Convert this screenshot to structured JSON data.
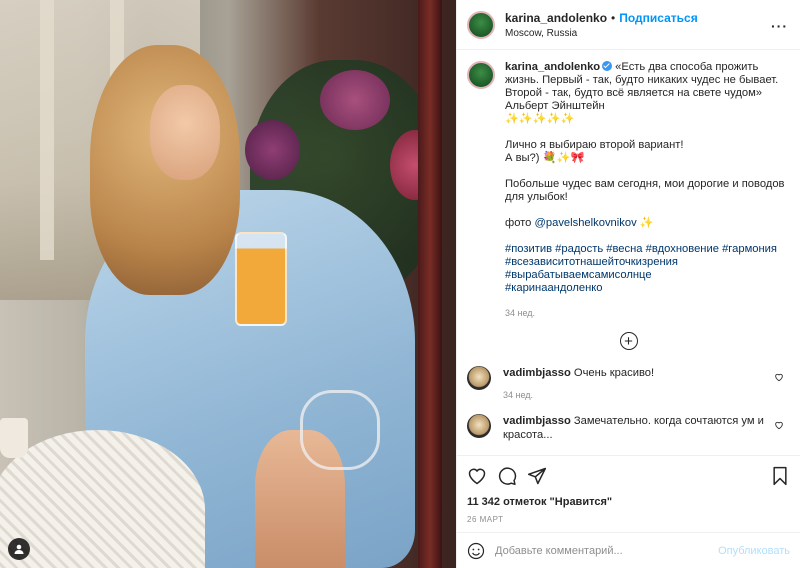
{
  "header": {
    "username": "karina_andolenko",
    "separator": "•",
    "follow_label": "Подписаться",
    "location": "Moscow, Russia",
    "more_label": "···"
  },
  "caption": {
    "username": "karina_andolenko",
    "paragraphs": [
      "«Есть два способа прожить жизнь. Первый - так, будто никаких чудес не бывает. Второй - так, будто всё является на свете чудом» Альберт Эйнштейн\n✨✨✨✨✨",
      "Лично я выбираю второй вариант!\nА вы?) 💐✨🎀",
      "Побольше чудес вам сегодня, мои дорогие и поводов для улыбок!"
    ],
    "photo_prefix": "фото ",
    "photo_credit": "@pavelshelkovnikov",
    "photo_suffix": " ✨",
    "hashtags_line1": "#позитив #радость #весна #вдохновение #гармония",
    "hashtags_line2": "#всезависитотнашейточкизрения",
    "hashtags_line3": "#вырабатываемсамисолнце",
    "hashtags_line4": "#каринаандоленко",
    "time": "34 нед."
  },
  "load_more": "+",
  "comments": [
    {
      "username": "vadimbjasso",
      "text": "Очень красиво!",
      "time": "34 нед."
    },
    {
      "username": "vadimbjasso",
      "text": "Замечательно. когда сочтаются ум и красота..."
    }
  ],
  "actions": {
    "likes": "11 342 отметок \"Нравится\"",
    "date": "26 МАРТ"
  },
  "add_comment": {
    "placeholder": "Добавьте комментарий...",
    "post_label": "Опубликовать"
  },
  "colors": {
    "accent": "#0095f6",
    "post_disabled": "#b2dffc",
    "verified": "#3897f0",
    "link": "#00376b"
  }
}
